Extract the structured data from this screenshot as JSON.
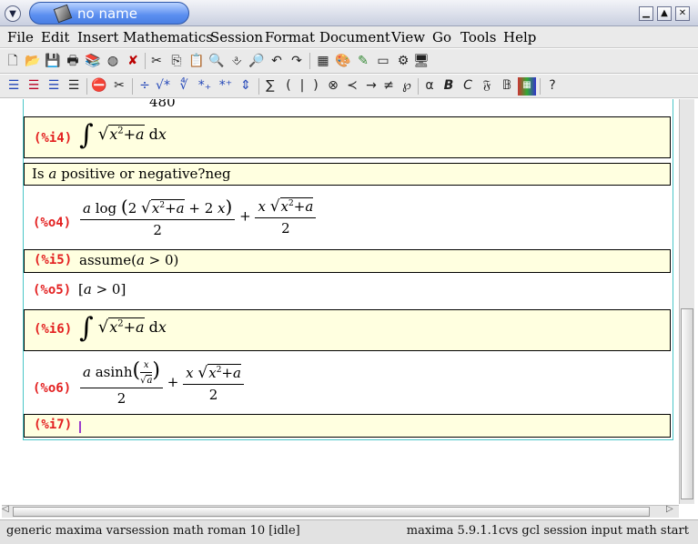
{
  "window": {
    "title": "no name"
  },
  "menu": [
    "File",
    "Edit",
    "Insert",
    "Mathematics",
    "Session",
    "Format",
    "Document",
    "View",
    "Go",
    "Tools",
    "Help"
  ],
  "toolbar2_symbols": [
    "∑",
    "(",
    "|",
    ")",
    "⊗",
    "≺",
    "→",
    "≠",
    "℘",
    "α",
    "B",
    "C",
    "𝔉",
    "𝔹",
    "?"
  ],
  "session": {
    "prev_output": "480",
    "i4": {
      "label": "(%i4)"
    },
    "question": {
      "text": "Is ",
      "var": "a",
      "rest": " positive or negative?neg"
    },
    "o4": {
      "label": "(%o4)"
    },
    "i5": {
      "label": "(%i5)",
      "text": "assume(",
      "var": "a",
      "rest": " > 0)"
    },
    "o5": {
      "label": "(%o5)",
      "text": "[",
      "var": "a",
      "rest": " > 0]"
    },
    "i6": {
      "label": "(%i6)"
    },
    "o6": {
      "label": "(%o6)"
    },
    "i7": {
      "label": "(%i7)"
    }
  },
  "status": {
    "left": "generic maxima varsession math roman 10 [idle]",
    "right": "maxima 5.9.1.1cvs gcl session input math start"
  },
  "colors": {
    "label": "#e32020",
    "input_bg": "#ffffe0",
    "session_border": "#4ac6c8",
    "title_pill": "#4a7fe3"
  }
}
